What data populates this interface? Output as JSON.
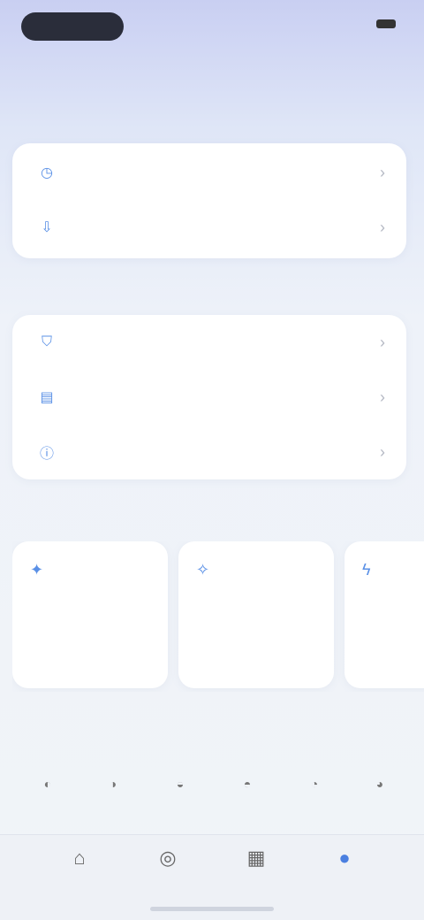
{
  "status_bar": {
    "pill_text": "",
    "right_text": ""
  },
  "page": {
    "title": ""
  },
  "section1": {
    "label": "",
    "items": [
      {
        "icon": "clock-icon",
        "glyph": "◷",
        "label": ""
      },
      {
        "icon": "download-icon",
        "glyph": "⇩",
        "label": ""
      }
    ]
  },
  "section2": {
    "label": "",
    "items": [
      {
        "icon": "shield-icon",
        "glyph": "⛉",
        "label": ""
      },
      {
        "icon": "document-icon",
        "glyph": "▤",
        "label": ""
      },
      {
        "icon": "info-icon",
        "glyph": "ⓘ",
        "label": ""
      }
    ]
  },
  "section3": {
    "label": "",
    "cards": [
      {
        "icon": "star-icon",
        "glyph": "✦",
        "title": ""
      },
      {
        "icon": "sparkle-icon",
        "glyph": "✧",
        "title": ""
      },
      {
        "icon": "bolt-icon",
        "glyph": "ϟ",
        "title": ""
      }
    ]
  },
  "section4": {
    "label": "",
    "tools": [
      {
        "icon": "tool-icon-1",
        "glyph": "◐"
      },
      {
        "icon": "tool-icon-2",
        "glyph": "◑"
      },
      {
        "icon": "tool-icon-3",
        "glyph": "◒"
      },
      {
        "icon": "tool-icon-4",
        "glyph": "◓"
      },
      {
        "icon": "tool-icon-5",
        "glyph": "◔"
      },
      {
        "icon": "tool-icon-6",
        "glyph": "◕"
      }
    ]
  },
  "bottom_nav": {
    "items": [
      {
        "icon": "home-icon",
        "glyph": "⌂",
        "label": ""
      },
      {
        "icon": "compass-icon",
        "glyph": "◎",
        "label": ""
      },
      {
        "icon": "grid-icon",
        "glyph": "▦",
        "label": ""
      },
      {
        "icon": "user-icon",
        "glyph": "●",
        "label": ""
      }
    ],
    "active_index": 3
  },
  "colors": {
    "accent": "#5a90e6",
    "active_nav": "#4a7fe0"
  }
}
